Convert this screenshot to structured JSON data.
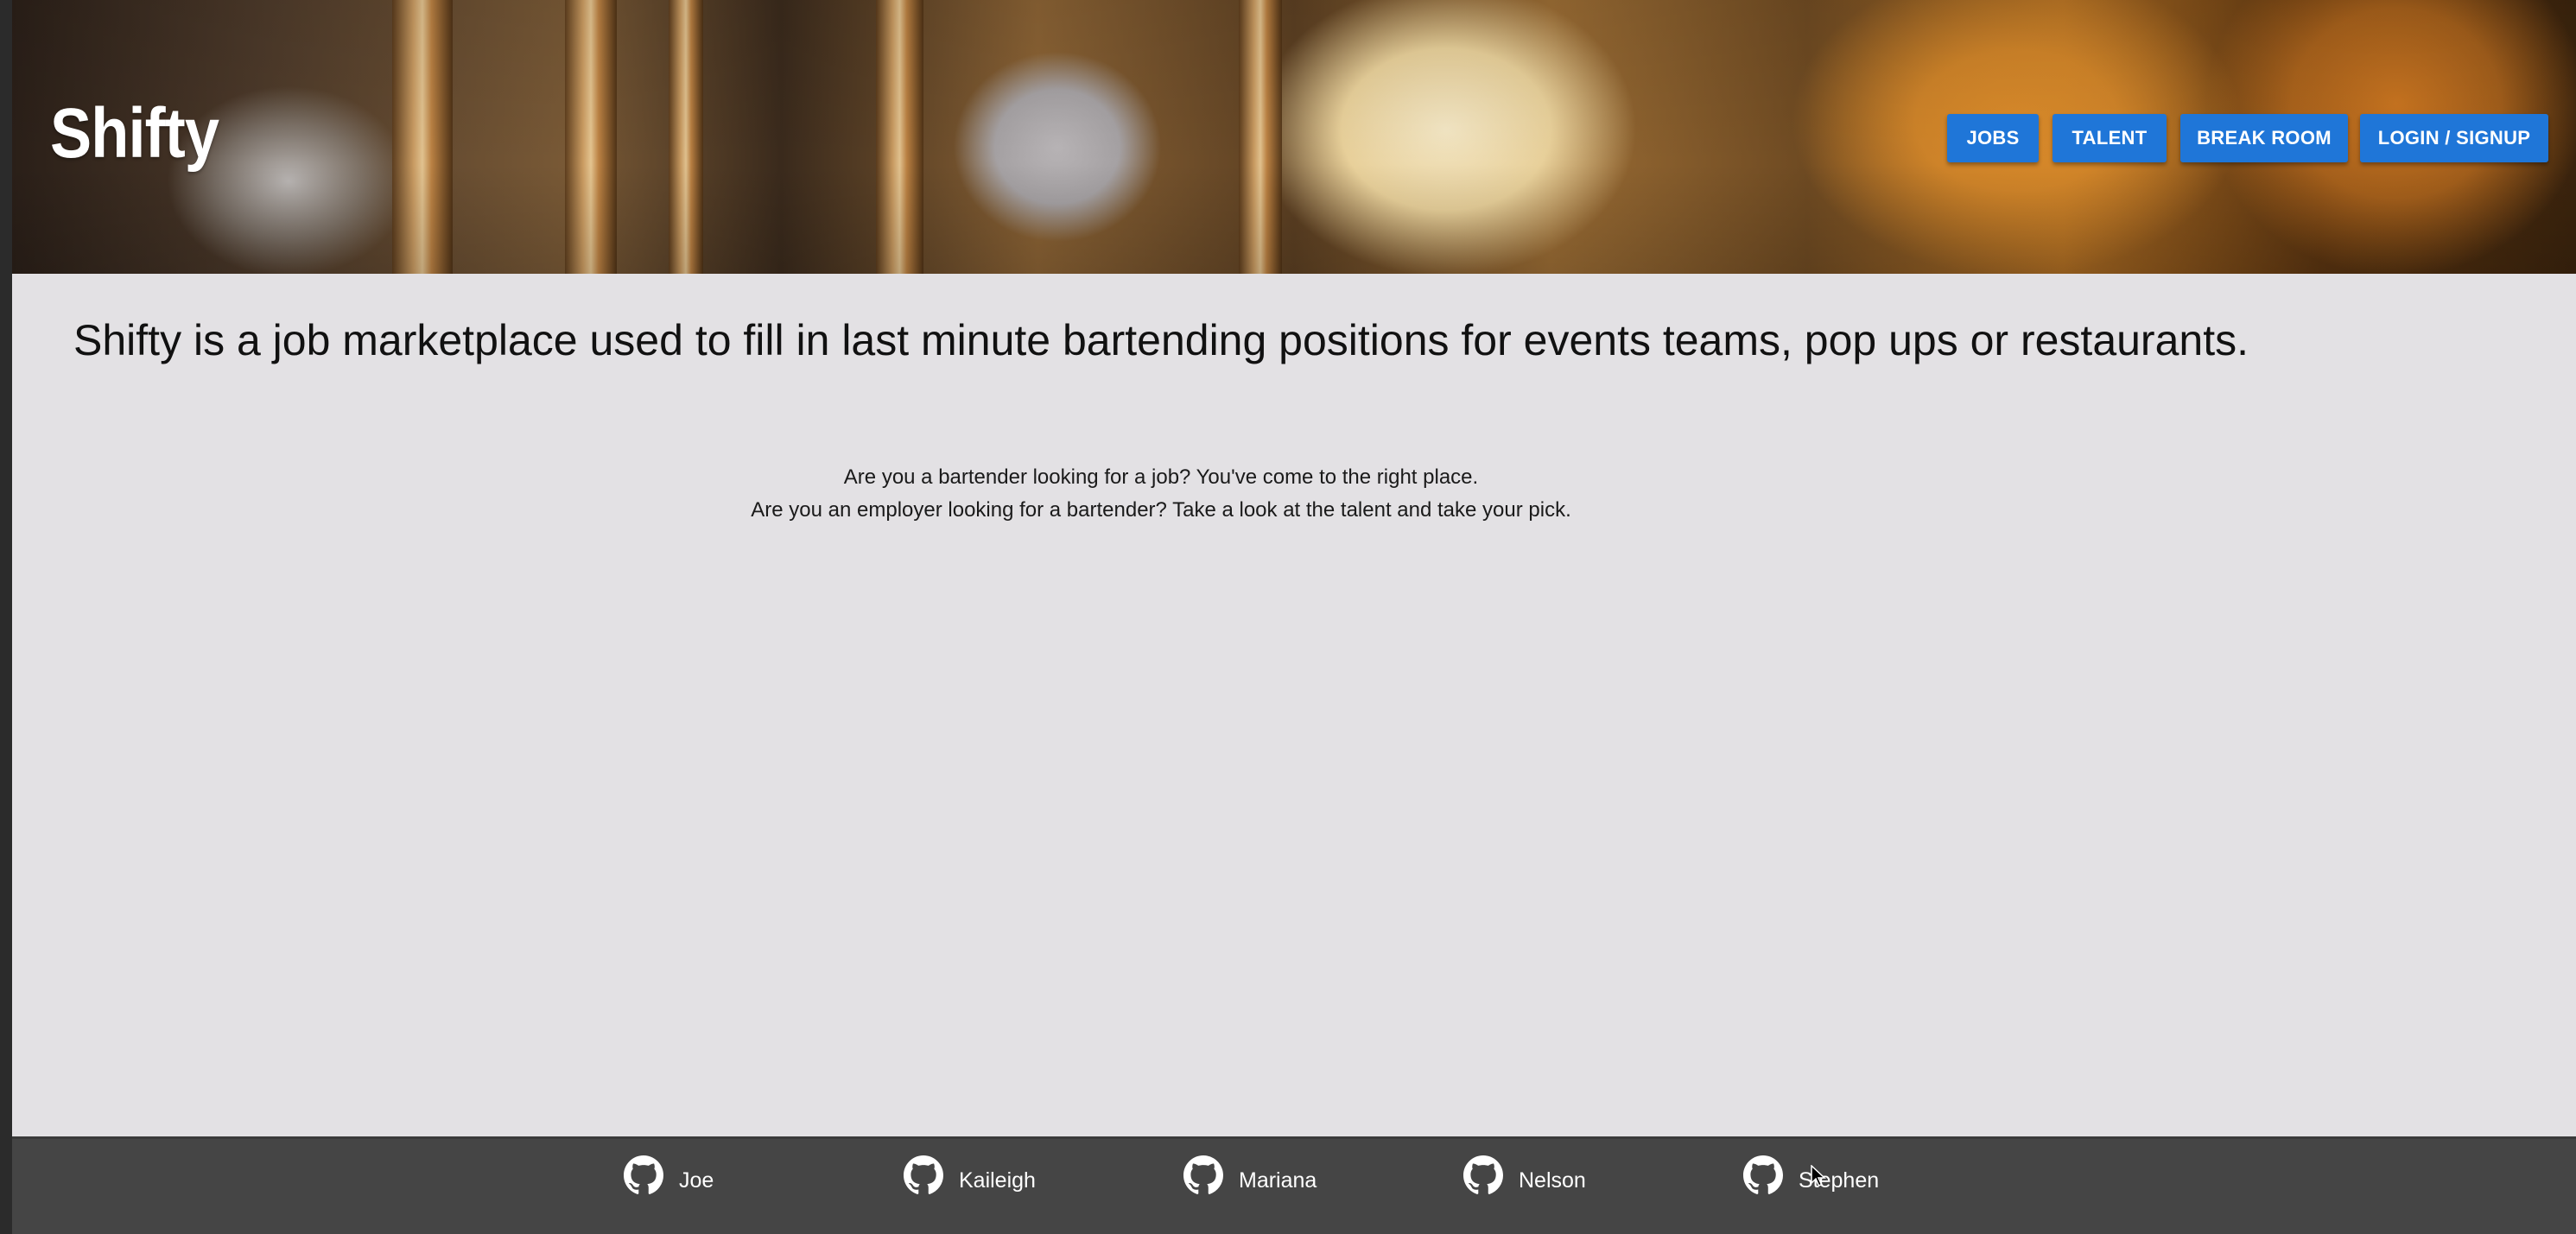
{
  "brand": {
    "name": "Shifty"
  },
  "nav": {
    "items": [
      {
        "label": "JOBS"
      },
      {
        "label": "TALENT"
      },
      {
        "label": "BREAK ROOM"
      },
      {
        "label": "LOGIN / SIGNUP"
      }
    ]
  },
  "main": {
    "headline": "Shifty is a job marketplace used to fill in last minute bartending positions for events teams, pop ups or restaurants.",
    "lines": [
      "Are you a bartender looking for a job? You've come to the right place.",
      "Are you an employer looking for a bartender? Take a look at the talent and take your pick."
    ]
  },
  "footer": {
    "icon": "github-icon",
    "links": [
      {
        "name": "Joe"
      },
      {
        "name": "Kaileigh"
      },
      {
        "name": "Mariana"
      },
      {
        "name": "Nelson"
      },
      {
        "name": "Stephen"
      }
    ]
  },
  "colors": {
    "nav_button": "#1f76d8",
    "page_background": "#e3e1e4",
    "footer_background": "#454545"
  }
}
